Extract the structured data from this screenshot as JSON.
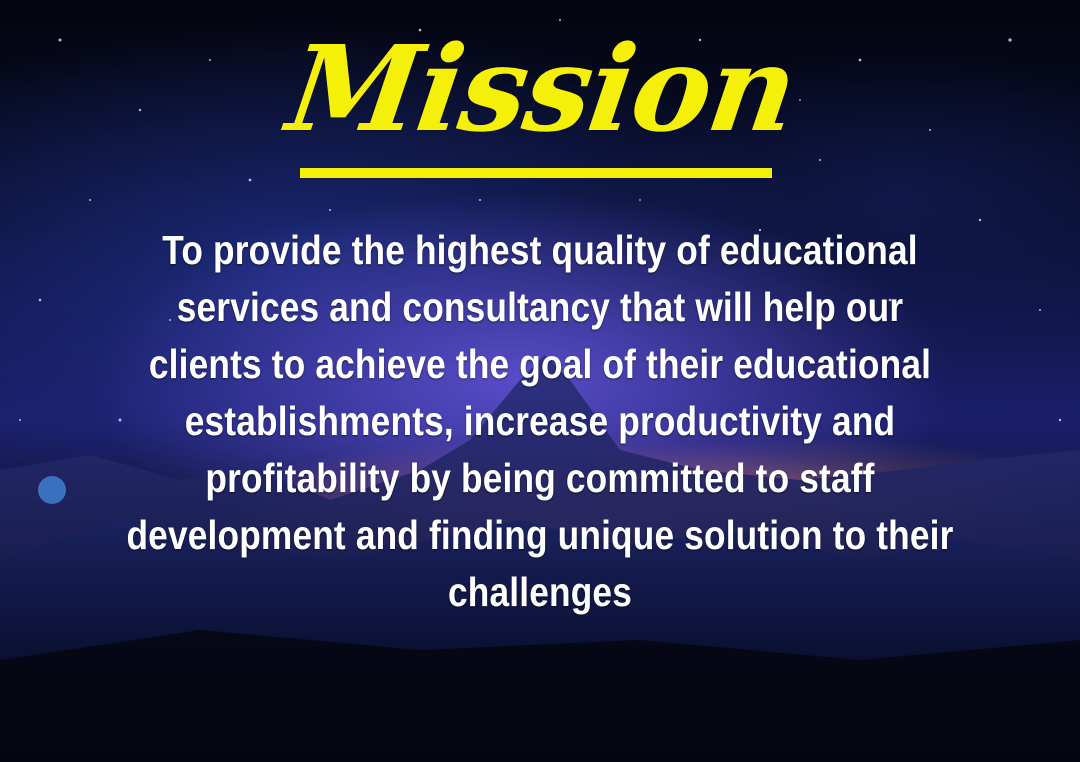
{
  "title": "Mission",
  "body_lines": [
    "To provide the highest quality of educational",
    "services and consultancy that will help our",
    "clients to achieve the goal of their educational",
    "establishments, increase productivity and",
    "profitability by being committed to staff",
    "development and finding unique solution to their",
    "challenges"
  ],
  "colors": {
    "title": "#f5f008",
    "body_text": "#ffffff",
    "background": "#0a1033"
  }
}
